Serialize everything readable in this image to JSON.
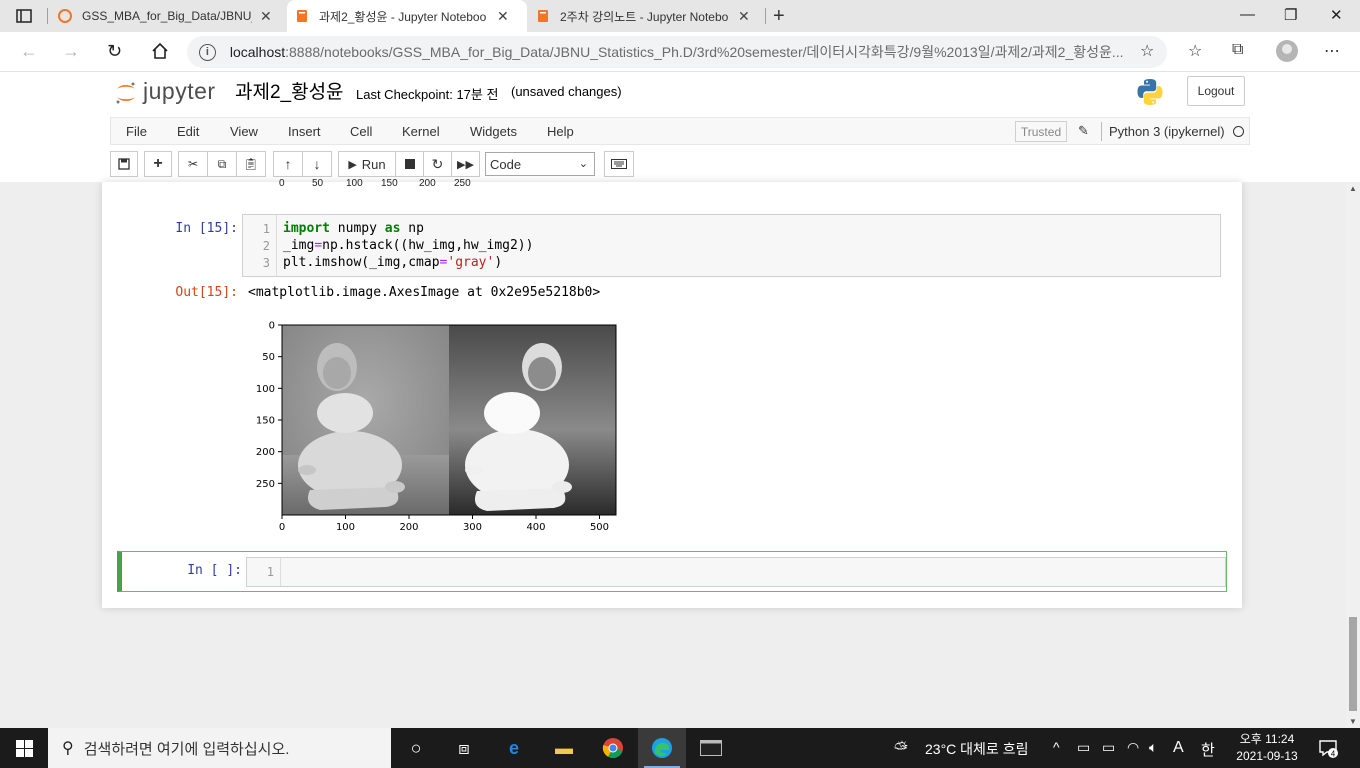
{
  "browser": {
    "tabs": [
      {
        "title": "GSS_MBA_for_Big_Data/JBNU_St",
        "active": false
      },
      {
        "title": "과제2_황성윤 - Jupyter Noteboo",
        "active": true
      },
      {
        "title": "2주차 강의노트 - Jupyter Notebo",
        "active": false
      }
    ],
    "url_host": "localhost",
    "url_path": ":8888/notebooks/GSS_MBA_for_Big_Data/JBNU_Statistics_Ph.D/3rd%20semester/데이터시각화특강/9월%2013일/과제2/과제2_황성윤..."
  },
  "jupyter": {
    "logo_text": "jupyter",
    "notebook_title": "과제2_황성윤",
    "checkpoint": "Last Checkpoint: 17분 전",
    "unsaved": "(unsaved changes)",
    "logout_label": "Logout",
    "menu": [
      "File",
      "Edit",
      "View",
      "Insert",
      "Cell",
      "Kernel",
      "Widgets",
      "Help"
    ],
    "trusted_label": "Trusted",
    "kernel_name": "Python 3 (ipykernel)",
    "toolbar": {
      "run_label": "Run",
      "cell_type": "Code"
    }
  },
  "notebook": {
    "prev_output_ticks": [
      "0",
      "50",
      "100",
      "150",
      "200",
      "250"
    ],
    "cell15": {
      "in_prompt": "In [15]:",
      "line_numbers": [
        "1",
        "2",
        "3"
      ],
      "out_prompt": "Out[15]:",
      "output_text": "<matplotlib.image.AxesImage at 0x2e95e5218b0>"
    },
    "empty_cell": {
      "in_prompt": "In [ ]:",
      "line_number": "1"
    }
  },
  "chart_data": {
    "type": "image",
    "x_ticks": [
      "0",
      "100",
      "200",
      "300",
      "400",
      "500"
    ],
    "y_ticks": [
      "0",
      "50",
      "100",
      "150",
      "200",
      "250"
    ],
    "xlim": [
      0,
      526
    ],
    "ylim": [
      300,
      0
    ],
    "cmap": "gray"
  },
  "taskbar": {
    "search_placeholder": "검색하려면 여기에 입력하십시오.",
    "weather": "23°C  대체로 흐림",
    "ime": "A",
    "lang": "한",
    "time": "오후 11:24",
    "date": "2021-09-13",
    "notif_count": "4"
  },
  "colors": {
    "jupyter_orange": "#f37626",
    "prompt_in": "#303f9f",
    "prompt_out": "#d84315",
    "edit_mode_green": "#42a548",
    "keyword_green": "#008000",
    "string_red": "#ba2121"
  }
}
